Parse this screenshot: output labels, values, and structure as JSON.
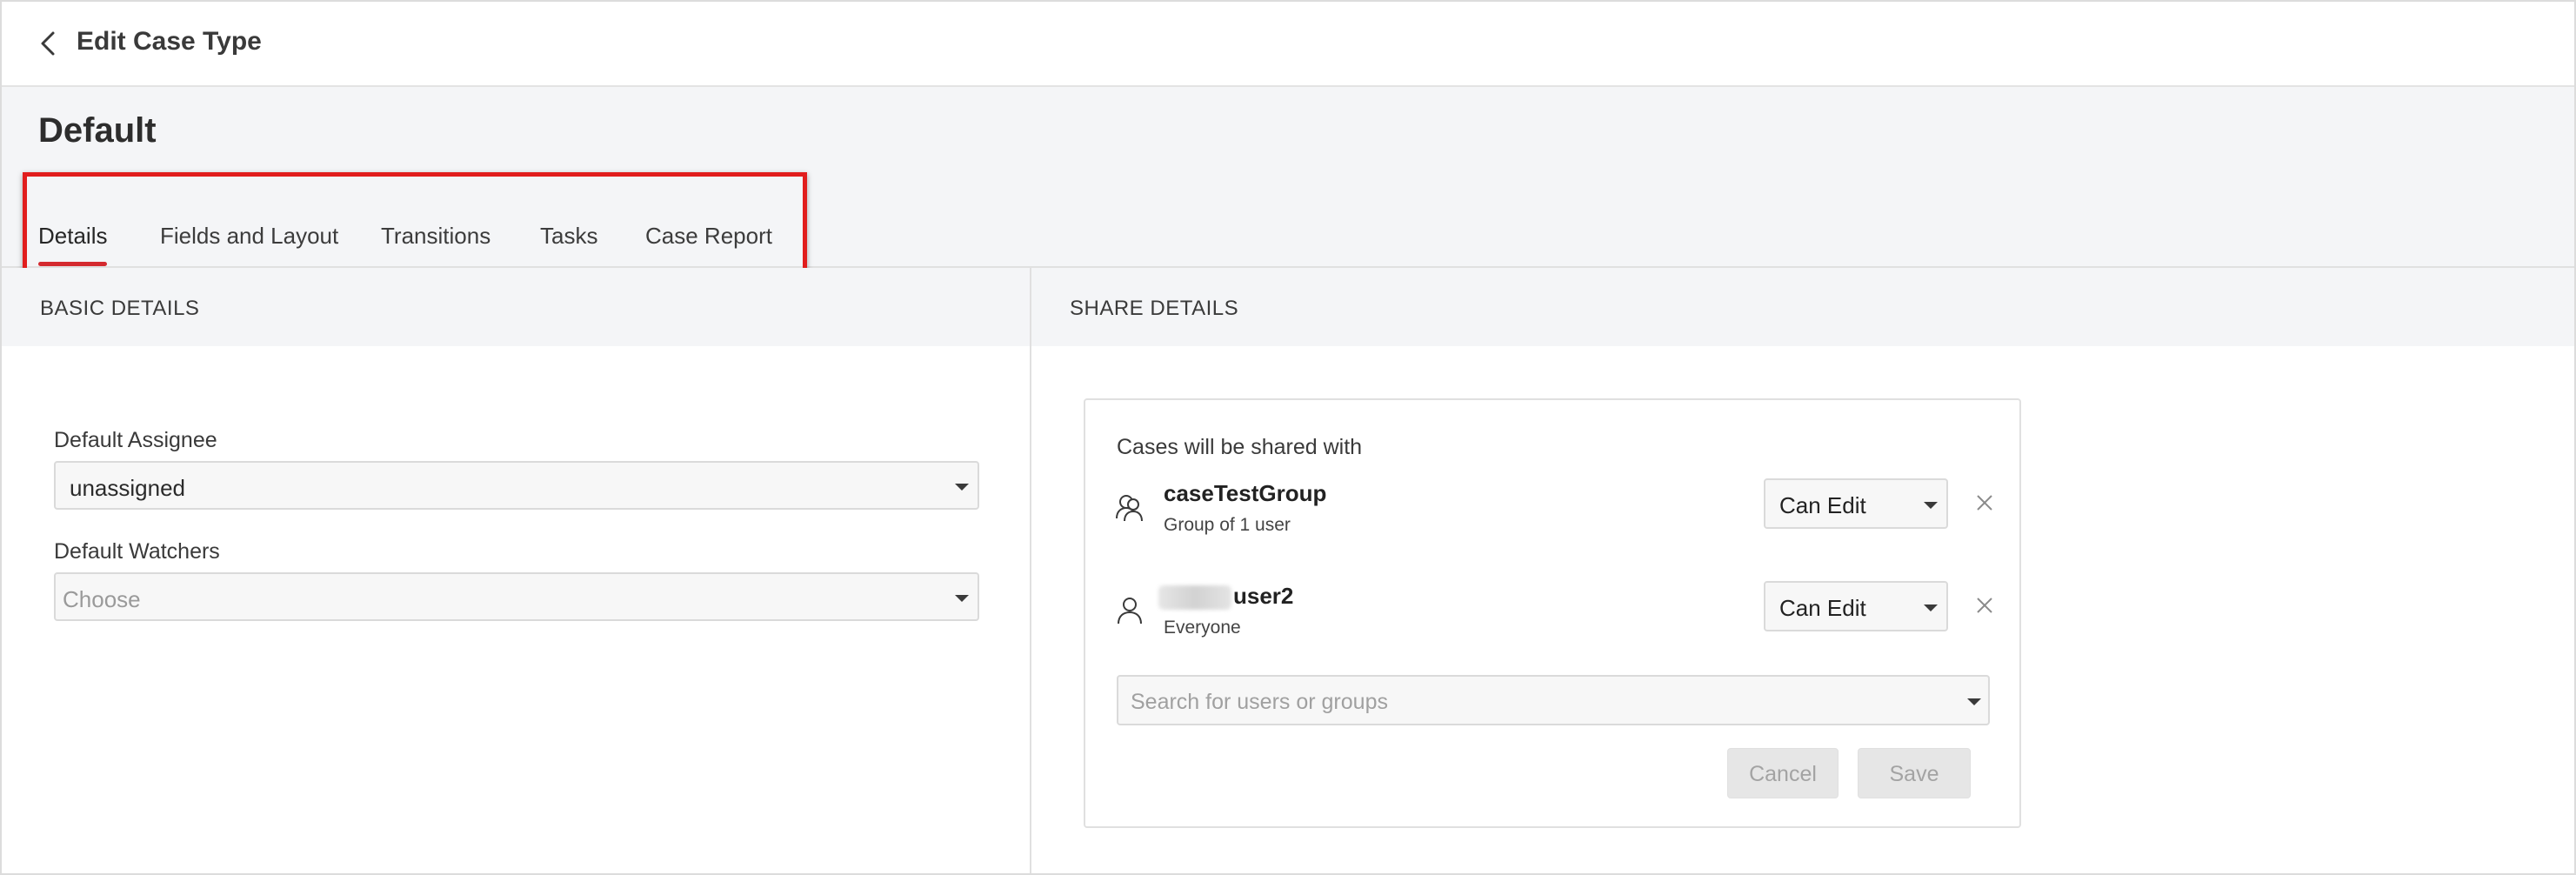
{
  "header": {
    "title": "Edit Case Type"
  },
  "case": {
    "name": "Default"
  },
  "tabs": [
    {
      "label": "Details",
      "active": true
    },
    {
      "label": "Fields and Layout",
      "active": false
    },
    {
      "label": "Transitions",
      "active": false
    },
    {
      "label": "Tasks",
      "active": false
    },
    {
      "label": "Case Report",
      "active": false
    }
  ],
  "basic_details": {
    "heading": "BASIC DETAILS",
    "assignee": {
      "label": "Default Assignee",
      "value": "unassigned"
    },
    "watchers": {
      "label": "Default Watchers",
      "placeholder": "Choose"
    }
  },
  "share_details": {
    "heading": "SHARE DETAILS",
    "card_heading": "Cases will be shared with",
    "entries": [
      {
        "name": "caseTestGroup",
        "subtitle": "Group of 1 user",
        "permission": "Can Edit",
        "icon": "group-icon"
      },
      {
        "name": "user2",
        "subtitle": "Everyone",
        "permission": "Can Edit",
        "icon": "user-icon"
      }
    ],
    "search_placeholder": "Search for users or groups",
    "cancel_label": "Cancel",
    "save_label": "Save"
  },
  "colors": {
    "accent": "#d42a2f",
    "highlight": "#e11d1d",
    "band": "#f4f5f7"
  }
}
